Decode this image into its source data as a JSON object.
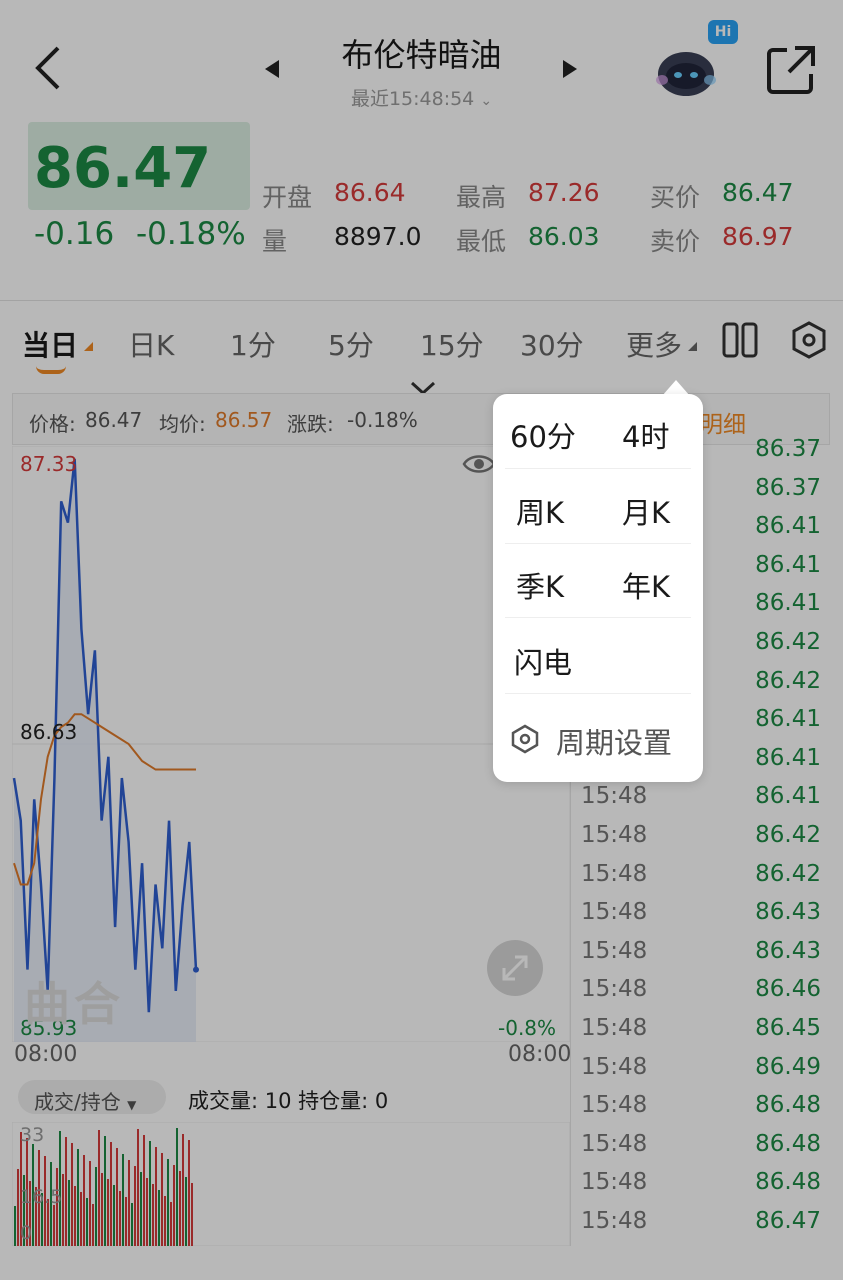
{
  "header": {
    "title": "布伦特暗油",
    "subtitle": "最近15:48:54",
    "hi_badge": "Hi"
  },
  "quote": {
    "price": "86.47",
    "change": "-0.16",
    "change_pct": "-0.18%",
    "open_label": "开盘",
    "open_value": "86.64",
    "high_label": "最高",
    "high_value": "87.26",
    "bid_label": "买价",
    "bid_value": "86.47",
    "volume_label": "量",
    "volume_value": "8897.0",
    "low_label": "最低",
    "low_value": "86.03",
    "ask_label": "卖价",
    "ask_value": "86.97"
  },
  "tabs": [
    {
      "label": "当日"
    },
    {
      "label": "日K"
    },
    {
      "label": "1分"
    },
    {
      "label": "5分"
    },
    {
      "label": "15分"
    },
    {
      "label": "30分"
    },
    {
      "label": "更多"
    }
  ],
  "chart_header": {
    "price_label": "价格:",
    "price_value": "86.47",
    "avg_label": "均价:",
    "avg_value": "86.57",
    "change_label": "涨跌:",
    "change_value": "-0.18%",
    "detail_tab": "明细"
  },
  "chart_axis": {
    "y_max": "87.33",
    "y_mid": "86.63",
    "y_min": "85.93",
    "pct_min": "-0.8%",
    "x_start": "08:00",
    "x_end": "08:00"
  },
  "watermark": "曲合",
  "volume": {
    "selector_label": "成交/持仓",
    "info": "成交量: 10 持仓量: 0",
    "y_max": "33",
    "y_mid": "16.5",
    "y_min": "0"
  },
  "ticks": [
    {
      "time": "",
      "price": "86.37"
    },
    {
      "time": "",
      "price": "86.37"
    },
    {
      "time": "",
      "price": "86.41"
    },
    {
      "time": "",
      "price": "86.41"
    },
    {
      "time": "",
      "price": "86.41"
    },
    {
      "time": "",
      "price": "86.42"
    },
    {
      "time": "",
      "price": "86.42"
    },
    {
      "time": "",
      "price": "86.41"
    },
    {
      "time": "",
      "price": "86.41"
    },
    {
      "time": "15:48",
      "price": "86.41"
    },
    {
      "time": "15:48",
      "price": "86.42"
    },
    {
      "time": "15:48",
      "price": "86.42"
    },
    {
      "time": "15:48",
      "price": "86.43"
    },
    {
      "time": "15:48",
      "price": "86.43"
    },
    {
      "time": "15:48",
      "price": "86.46"
    },
    {
      "time": "15:48",
      "price": "86.45"
    },
    {
      "time": "15:48",
      "price": "86.49"
    },
    {
      "time": "15:48",
      "price": "86.48"
    },
    {
      "time": "15:48",
      "price": "86.48"
    },
    {
      "time": "15:48",
      "price": "86.48"
    },
    {
      "time": "15:48",
      "price": "86.47"
    }
  ],
  "popup": {
    "items": [
      "60分",
      "4时",
      "周K",
      "月K",
      "季K",
      "年K",
      "闪电"
    ],
    "settings_label": "周期设置"
  },
  "colors": {
    "up": "#d63b3b",
    "down": "#1c8a45",
    "accent": "#f08a24",
    "price_line": "#2f5fd0",
    "avg_line": "#e07a2a"
  },
  "chart_data": {
    "type": "line",
    "title": "",
    "xlabel": "",
    "ylabel": "",
    "ylim": [
      85.93,
      87.33
    ],
    "series": [
      {
        "name": "价格",
        "values": [
          86.55,
          86.45,
          86.1,
          86.5,
          86.3,
          86.05,
          86.55,
          87.2,
          87.15,
          87.3,
          86.9,
          86.7,
          86.85,
          86.45,
          86.6,
          86.2,
          86.55,
          86.4,
          86.1,
          86.35,
          86.0,
          86.3,
          86.15,
          86.45,
          86.05,
          86.25,
          86.4,
          86.1
        ]
      },
      {
        "name": "均价",
        "values": [
          86.35,
          86.3,
          86.3,
          86.35,
          86.5,
          86.6,
          86.65,
          86.67,
          86.68,
          86.7,
          86.7,
          86.69,
          86.68,
          86.67,
          86.66,
          86.65,
          86.64,
          86.63,
          86.61,
          86.59,
          86.58,
          86.57,
          86.57,
          86.57,
          86.57,
          86.57,
          86.57,
          86.57
        ]
      }
    ]
  }
}
